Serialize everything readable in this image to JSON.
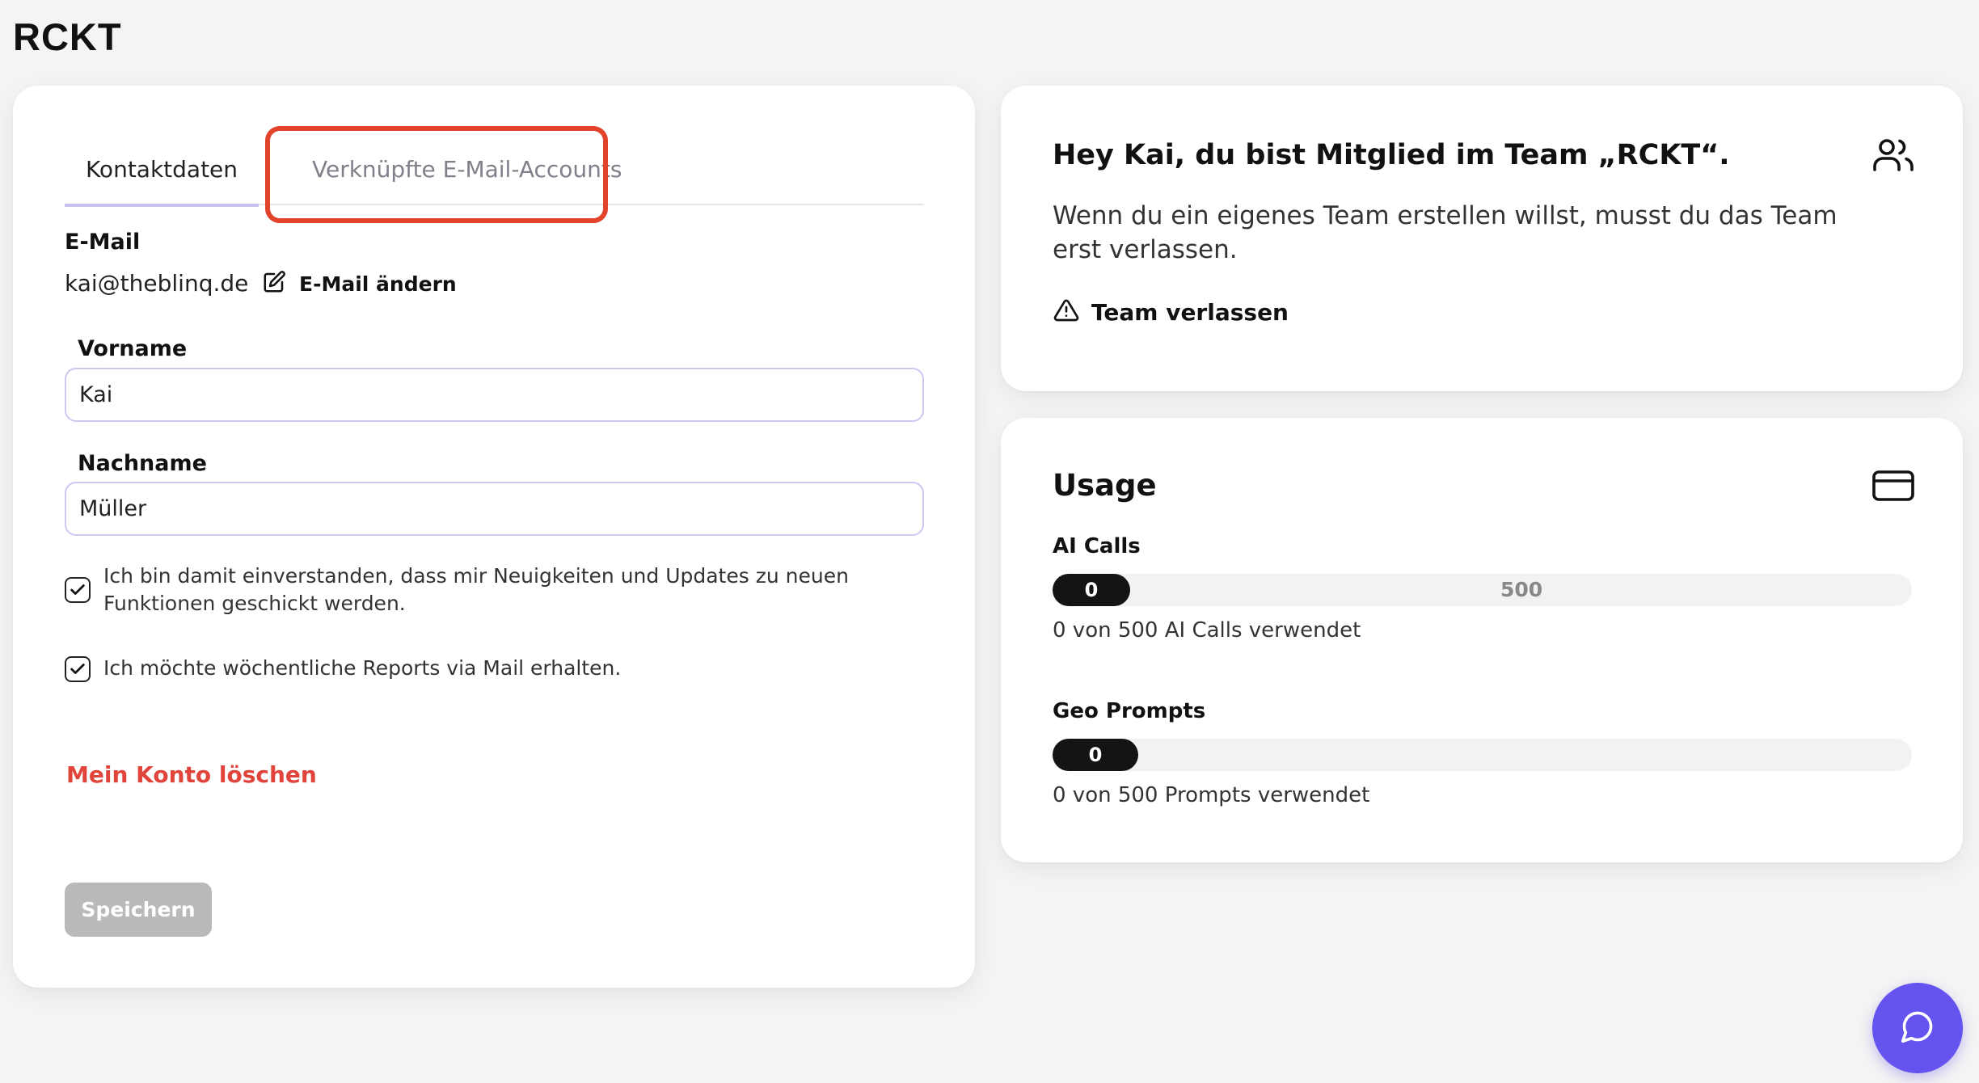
{
  "app": {
    "logo": "RCKT"
  },
  "profile": {
    "tabs": [
      {
        "label": "Kontaktdaten",
        "active": true
      },
      {
        "label": "Verknüpfte E-Mail-Accounts",
        "active": false
      }
    ],
    "email_label": "E-Mail",
    "email_value": "kai@theblinq.de",
    "edit_email_label": "E-Mail ändern",
    "firstname_label": "Vorname",
    "firstname_value": "Kai",
    "lastname_label": "Nachname",
    "lastname_value": "Müller",
    "checkboxes": [
      {
        "label": "Ich bin damit einverstanden, dass mir Neuigkeiten und Updates zu neuen Funktionen geschickt werden.",
        "checked": true
      },
      {
        "label": "Ich möchte wöchentliche Reports via Mail erhalten.",
        "checked": true
      }
    ],
    "delete_label": "Mein Konto löschen",
    "save_label": "Speichern"
  },
  "team": {
    "title": "Hey Kai, du bist Mitglied im Team „RCKT“.",
    "text": "Wenn du ein eigenes Team erstellen willst, musst du das Team erst verlassen.",
    "leave_label": "Team verlassen",
    "icon": "users-icon"
  },
  "usage": {
    "title": "Usage",
    "icon": "credit-card-icon",
    "meters": [
      {
        "label": "AI Calls",
        "used": "0",
        "max": "500",
        "fraction": 0,
        "text": "0 von 500 AI Calls verwendet"
      },
      {
        "label": "Geo Prompts",
        "used": "0",
        "max": "",
        "fraction": 0,
        "text": "0 von 500 Prompts verwendet"
      }
    ]
  },
  "colors": {
    "accent": "#6553f0",
    "highlight": "#e2432a",
    "danger": "#e0443a",
    "input_border": "#cdc7f1"
  }
}
